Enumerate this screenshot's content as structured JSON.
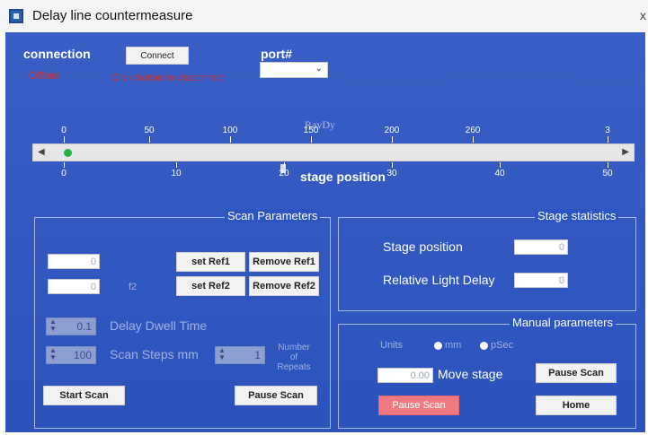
{
  "window": {
    "title": "Delay line countermeasure",
    "close_glyph": "x"
  },
  "connection": {
    "label": "connection",
    "connect_button": "Connect",
    "status": "Offline",
    "hint": "Click button to disconnect",
    "port_label": "port#",
    "port_value": ""
  },
  "stage": {
    "top_ticks": [
      "0",
      "50",
      "100",
      "150",
      "200",
      "260",
      "3"
    ],
    "axis_annotation": "RavDy",
    "bottom_ticks": [
      "0",
      "10",
      "20",
      "30",
      "40",
      "50"
    ],
    "position_label": "stage position",
    "slider_position_fraction": 0.0
  },
  "scan": {
    "title": "Scan Parameters",
    "ref1_value": "0",
    "ref2_value": "0",
    "f2_label": "f2",
    "set_ref1": "set Ref1",
    "remove_ref1": "Remove Ref1",
    "set_ref2": "set Ref2",
    "remove_ref2": "Remove Ref2",
    "dwell_value": "0.1",
    "dwell_label": "Delay Dwell Time",
    "steps_value": "100",
    "steps_label": "Scan Steps mm",
    "repeats_value": "1",
    "repeats_label_1": "Number",
    "repeats_label_2": "of Repeats",
    "start_button": "Start Scan",
    "pause_button": "Pause Scan"
  },
  "stats": {
    "title": "Stage statistics",
    "position_label": "Stage position",
    "position_value": "0",
    "delay_label": "Relative Light Delay",
    "delay_value": "0"
  },
  "manual": {
    "title": "Manual parameters",
    "units_label": "Units",
    "unit_mm": "mm",
    "unit_psec": "pSec",
    "move_value": "0.00",
    "move_label": "Move stage",
    "pause_button": "Pause Scan",
    "pause_button_active": "Pause Scan",
    "home_button": "Home"
  },
  "colors": {
    "panel_bg": "#2d55c2",
    "slider_thumb": "#23b245",
    "status_red": "#d9302c",
    "active_button": "#f07a80"
  }
}
